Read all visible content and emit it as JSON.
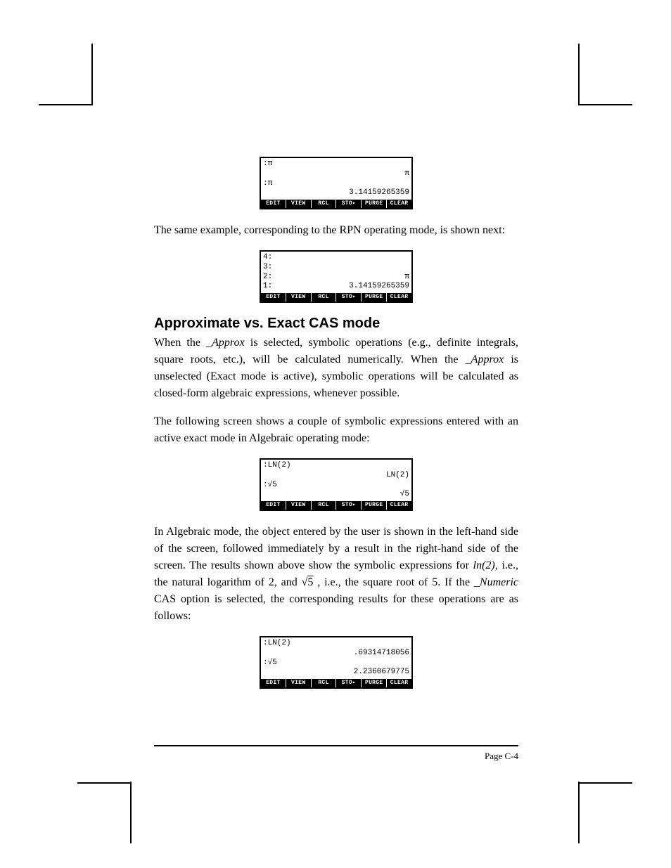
{
  "softkeys": [
    "EDIT",
    "VIEW",
    "RCL",
    "STO▸",
    "PURGE",
    "CLEAR"
  ],
  "scr1": {
    "rows": [
      {
        "l": ":π",
        "r": ""
      },
      {
        "l": "",
        "r": "π"
      },
      {
        "l": ":π",
        "r": ""
      },
      {
        "l": "",
        "r": "3.14159265359"
      }
    ]
  },
  "p1": "The same example, corresponding to the RPN operating mode, is shown next:",
  "scr2": {
    "rows": [
      {
        "l": "4:",
        "r": ""
      },
      {
        "l": "3:",
        "r": ""
      },
      {
        "l": "2:",
        "r": "π"
      },
      {
        "l": "1:",
        "r": "3.14159265359"
      }
    ]
  },
  "heading": "Approximate vs. Exact CAS mode",
  "p2a": "When the ",
  "p2b": "_Approx",
  "p2c": " is selected, symbolic operations (e.g., definite integrals, square roots, etc.), will be calculated numerically.  When the ",
  "p2d": "_Approx",
  "p2e": " is unselected (Exact mode is active), symbolic operations will be calculated as closed-form algebraic expressions, whenever possible.",
  "p3": "The following screen shows a couple of symbolic expressions entered with an active exact mode in Algebraic operating mode:",
  "scr3": {
    "rows": [
      {
        "l": ":LN(2)",
        "r": ""
      },
      {
        "l": "",
        "r": "LN(2)"
      },
      {
        "l": ":√5",
        "r": ""
      },
      {
        "l": "",
        "r": "√5"
      }
    ]
  },
  "p4a": "In Algebraic mode, the object entered by the user is shown in the left-hand side of the screen, followed immediately by a result in the right-hand side of the screen.  The results shown above show the symbolic expressions for ",
  "p4b": "ln(2)",
  "p4c": ", i.e., the natural logarithm of 2, and ",
  "p4_sqrt": "5",
  "p4d": " , i.e., the square root of 5.   If the ",
  "p4e": "_Numeric",
  "p4f": " CAS option is selected, the corresponding results for these operations are as follows:",
  "scr4": {
    "rows": [
      {
        "l": ":LN(2)",
        "r": ""
      },
      {
        "l": "",
        "r": ".69314718056"
      },
      {
        "l": ":√5",
        "r": ""
      },
      {
        "l": "",
        "r": "2.2360679775"
      }
    ]
  },
  "page_number": "Page C-4"
}
